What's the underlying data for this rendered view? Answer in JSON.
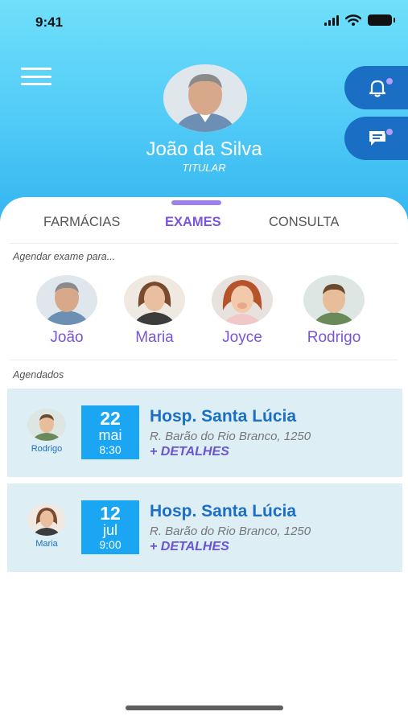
{
  "status_bar": {
    "time": "9:41"
  },
  "profile": {
    "name": "João da Silva",
    "role": "TITULAR"
  },
  "tabs": [
    {
      "label": "FARMÁCIAS",
      "active": false
    },
    {
      "label": "EXAMES",
      "active": true
    },
    {
      "label": "CONSULTA",
      "active": false
    }
  ],
  "schedule_for": {
    "label": "Agendar exame para...",
    "members": [
      {
        "name": "João"
      },
      {
        "name": "Maria"
      },
      {
        "name": "Joyce"
      },
      {
        "name": "Rodrigo"
      }
    ]
  },
  "scheduled": {
    "label": "Agendados",
    "items": [
      {
        "person": "Rodrigo",
        "day": "22",
        "month": "mai",
        "time": "8:30",
        "place": "Hosp. Santa Lúcia",
        "address": "R. Barão do Rio Branco, 1250",
        "details": "+ DETALHES"
      },
      {
        "person": "Maria",
        "day": "12",
        "month": "jul",
        "time": "9:00",
        "place": "Hosp. Santa Lúcia",
        "address": "R. Barão do Rio Branco, 1250",
        "details": "+ DETALHES"
      }
    ]
  },
  "icons": {
    "menu": "hamburger-menu-icon",
    "notifications": "bell-icon",
    "messages": "chat-icon"
  },
  "colors": {
    "header_gradient_top": "#6fe0fb",
    "header_gradient_bottom": "#2fb3f0",
    "accent_purple": "#7a55d9",
    "primary_blue": "#1a6fc4",
    "date_box": "#1aa6f2",
    "card_bg": "#deeef5"
  }
}
